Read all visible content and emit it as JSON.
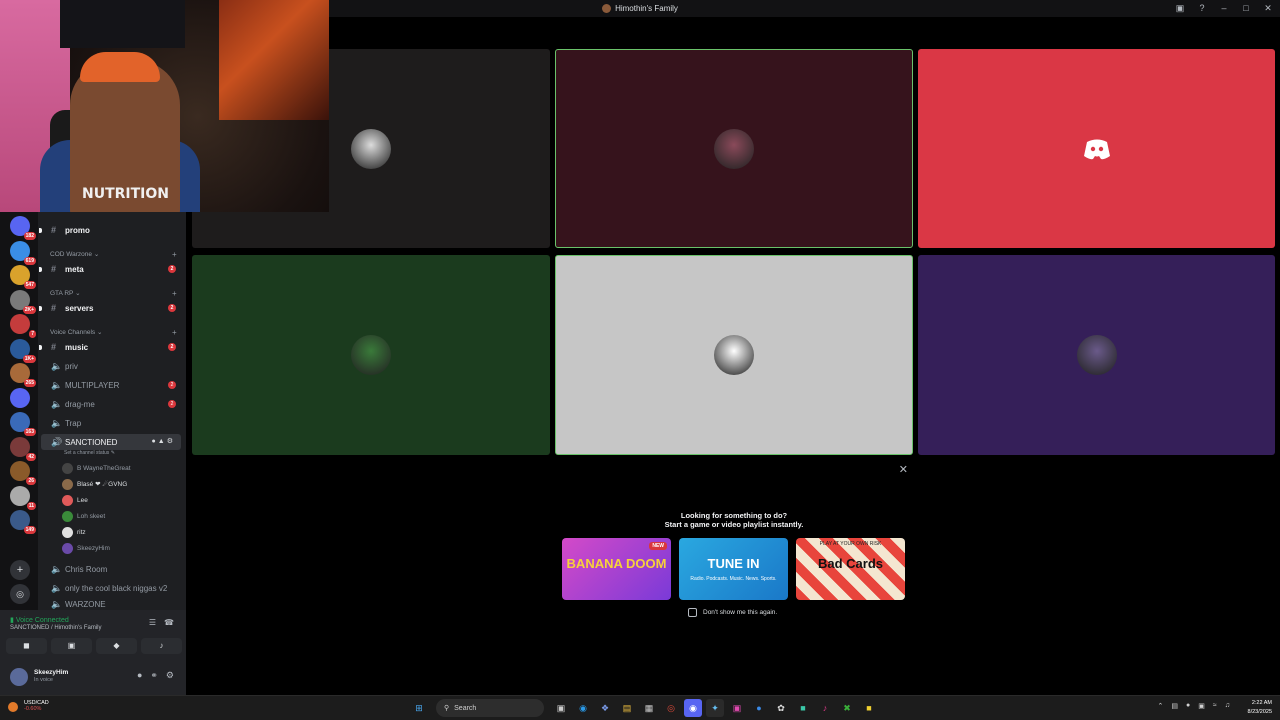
{
  "window": {
    "title": "Himothin's Family"
  },
  "webcam": {
    "shirt_text": "NUTRITION"
  },
  "servers": [
    {
      "badge": "182",
      "color": "#5865f2"
    },
    {
      "badge": "619",
      "color": "#3a8ee6"
    },
    {
      "badge": "547",
      "color": "#d9a22c"
    },
    {
      "badge": "2K+",
      "color": "#7a7a7a"
    },
    {
      "badge": "7",
      "color": "#c43c3c"
    },
    {
      "badge": "1K+",
      "color": "#2a5a9a"
    },
    {
      "badge": "265",
      "color": "#a86a3a"
    },
    {
      "badge": "",
      "color": "#5865f2"
    },
    {
      "badge": "163",
      "color": "#3a6ab8"
    },
    {
      "badge": "42",
      "color": "#7a3a3a"
    },
    {
      "badge": "26",
      "color": "#8a5a2a"
    },
    {
      "badge": "11",
      "color": "#aaaaaa"
    },
    {
      "badge": "149",
      "color": "#3a5a8a"
    }
  ],
  "sidebar": {
    "promo": "promo",
    "cat_cod": "COD Warzone",
    "meta": "meta",
    "meta_badge": "2",
    "cat_gtarp": "GTA RP",
    "servers_ch": "servers",
    "servers_badge": "2",
    "cat_voice": "Voice Channels",
    "music": "music",
    "music_badge": "2",
    "priv": "priv",
    "multiplayer": "MULTIPLAYER",
    "multiplayer_badge": "2",
    "dragme": "drag-me",
    "dragme_badge": "2",
    "trap": "Trap",
    "sanctioned": "SANCTIONED",
    "set_status": "Set a channel status",
    "voice_users": [
      {
        "name": "B WayneTheGreat",
        "color": "#444",
        "bright": false
      },
      {
        "name": "Blasé ❤ ☄GVNG",
        "color": "#8a6a4a",
        "bright": true
      },
      {
        "name": "Lee",
        "color": "#e05a5a",
        "bright": true
      },
      {
        "name": "Loh skeet",
        "color": "#3a8a3a",
        "bright": false
      },
      {
        "name": "ritz",
        "color": "#e0e0e0",
        "bright": true
      },
      {
        "name": "SkeezyHim",
        "color": "#6a4aa8",
        "bright": false
      }
    ],
    "chris_room": "Chris Room",
    "cool_ch": "only the cool black niggas v2",
    "warzone": "WARZONE"
  },
  "voice": {
    "connected": "Voice Connected",
    "location": "SANCTIONED / Himothin's Family"
  },
  "user": {
    "name": "SkeezyHim",
    "status": "In voice"
  },
  "tiles": [
    {
      "bg": "#1e1c1c",
      "avatar": "#dcdcdc",
      "speaking": false
    },
    {
      "bg": "#36131c",
      "avatar": "#8a4a5a",
      "speaking": true
    },
    {
      "bg": "#da3745",
      "avatar": "#da3745",
      "speaking": false,
      "discord": true
    },
    {
      "bg": "#1b3b1e",
      "avatar": "#3a7a3a",
      "speaking": false
    },
    {
      "bg": "#c6c6c6",
      "avatar": "#ffffff",
      "speaking": true
    },
    {
      "bg": "#351f59",
      "avatar": "#6a5a8a",
      "speaking": false
    }
  ],
  "activity": {
    "line1": "Looking for something to do?",
    "line2": "Start a game or video playlist instantly.",
    "cards": [
      {
        "label": "BANANA DOOM",
        "tag": "NEW",
        "sub": ""
      },
      {
        "label": "TUNE IN",
        "tag": "",
        "sub": "Radio. Podcasts. Music. News. Sports."
      },
      {
        "label": "Bad Cards",
        "tag": "",
        "sub": "PLAY AT YOUR OWN RISK"
      }
    ],
    "dont_show": "Don't show me this again."
  },
  "taskbar": {
    "ticker_name": "USD/CAD",
    "ticker_change": "-0.60%",
    "search": "Search",
    "time": "2:22 AM",
    "date": "8/23/2025"
  }
}
